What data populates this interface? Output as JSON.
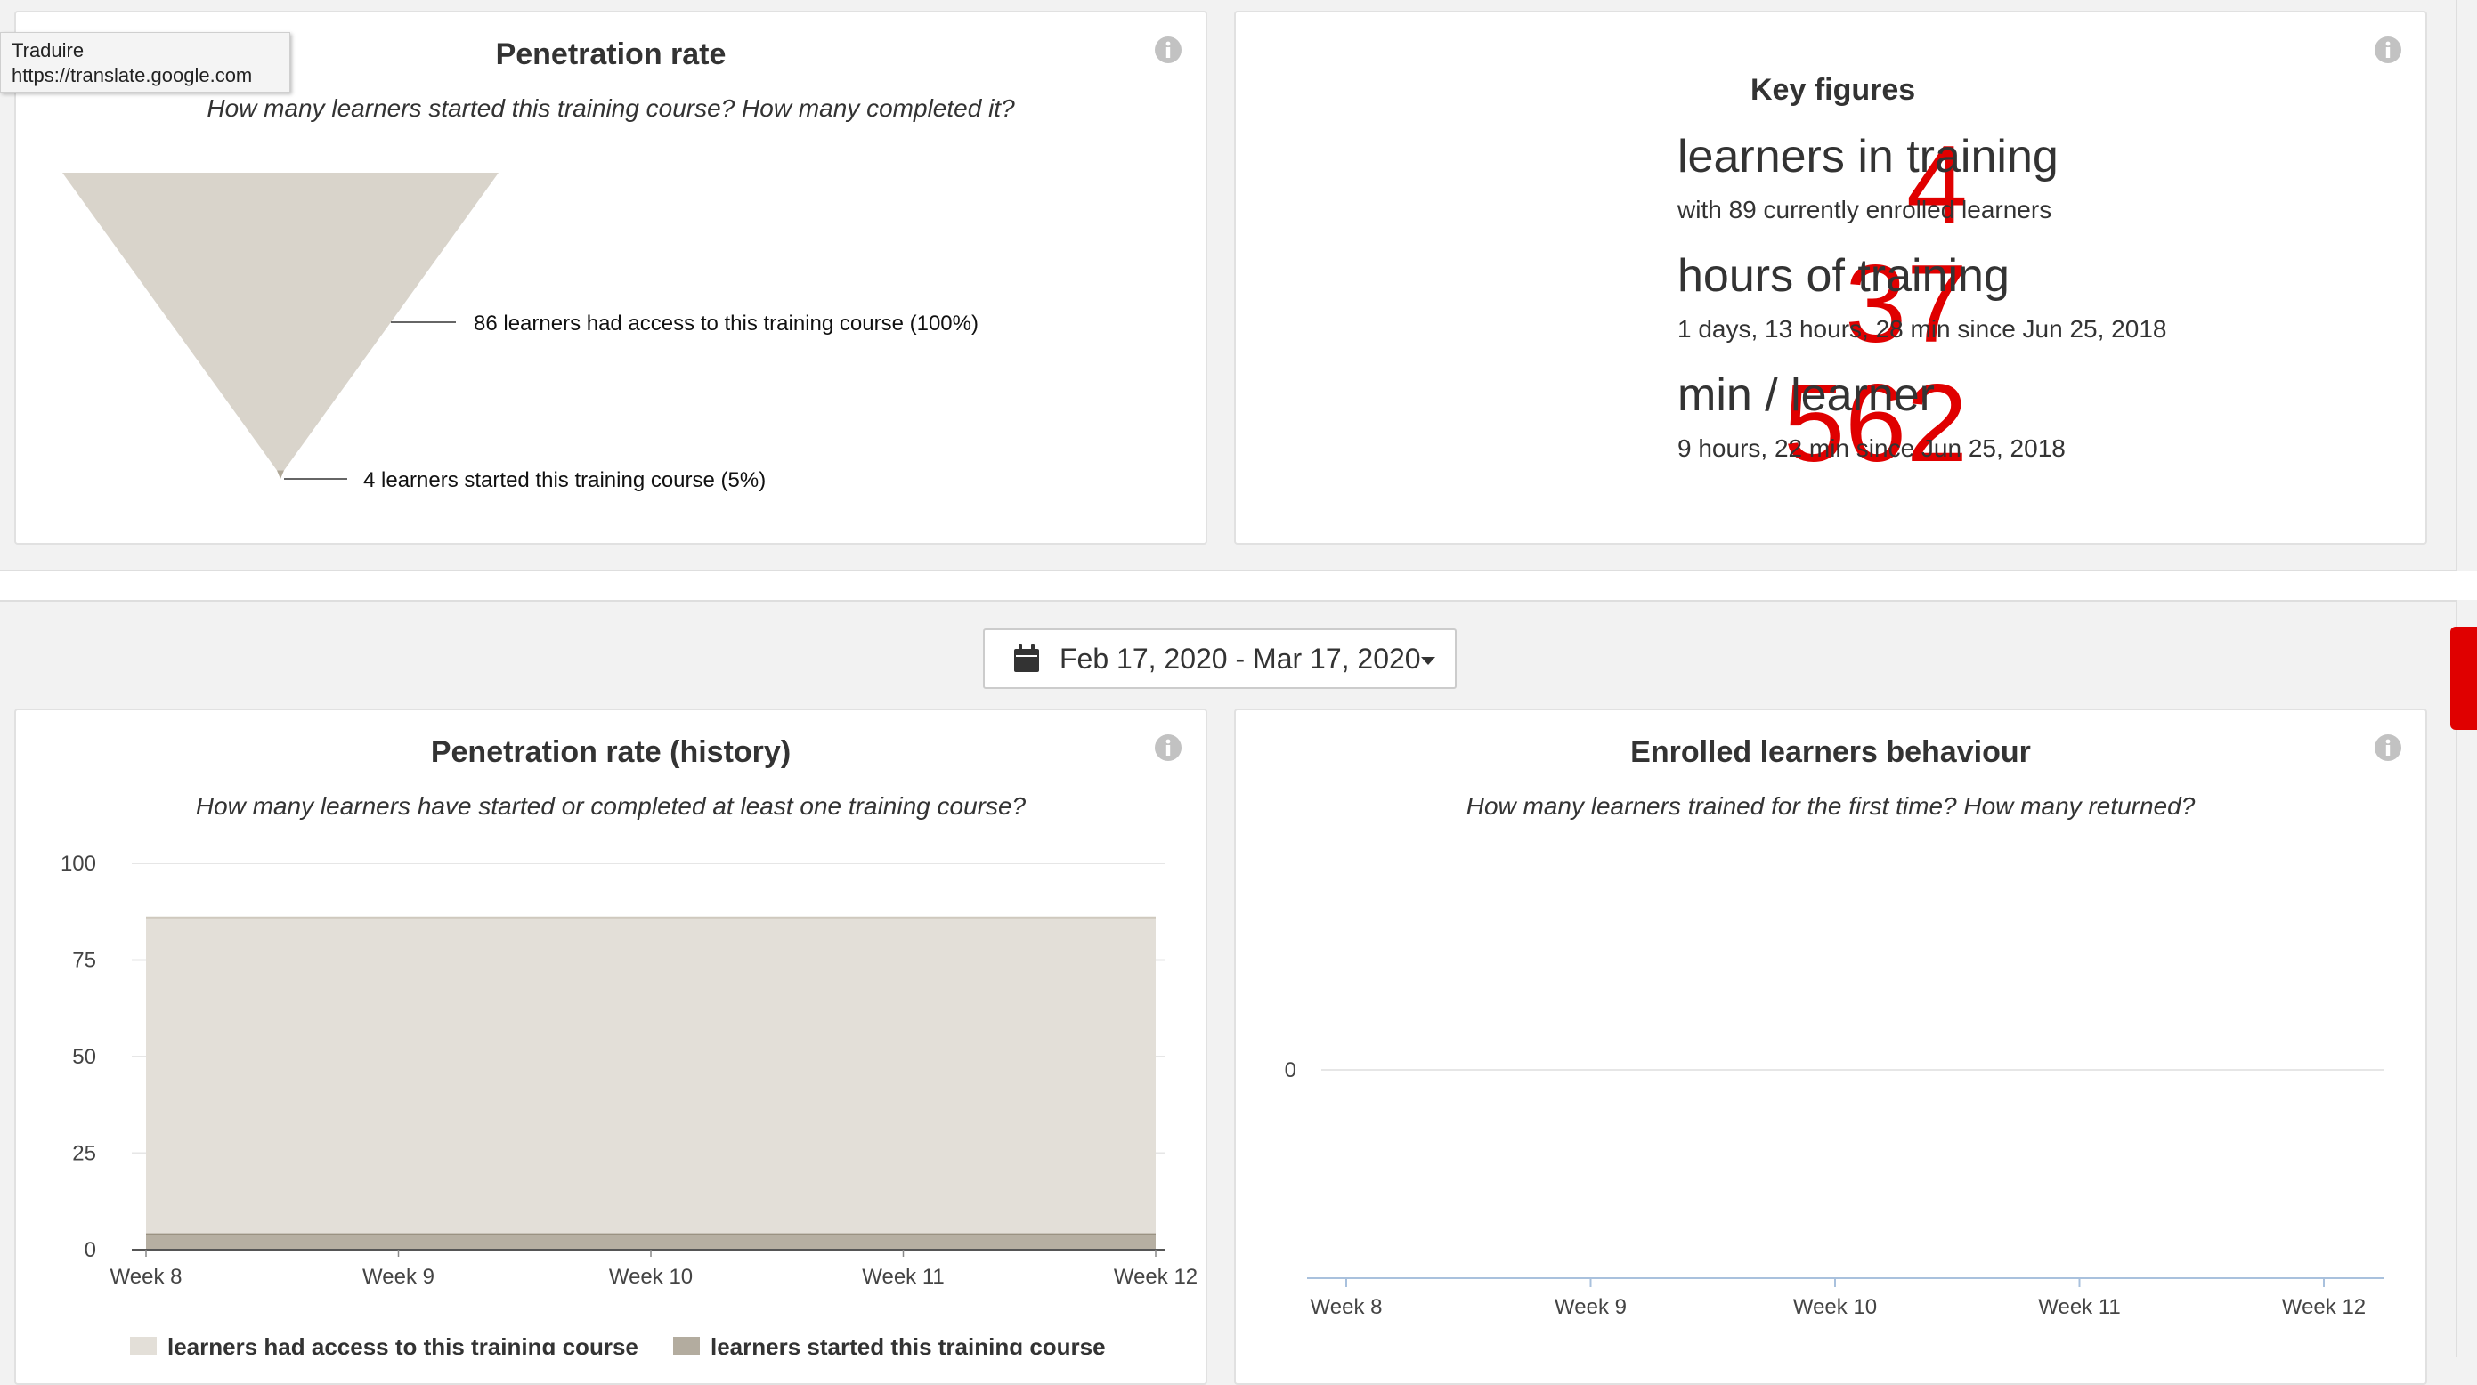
{
  "tooltip": {
    "title": "Traduire",
    "url": "https://translate.google.com"
  },
  "funnel_card": {
    "title": "Penetration rate",
    "subtitle": "How many learners started this training course? How many completed it?",
    "chart_data": {
      "type": "funnel",
      "stages": [
        {
          "label": "86 learners had access to this training course (100%)",
          "value": 86,
          "percent": 100
        },
        {
          "label": "4 learners started this training course (5%)",
          "value": 4,
          "percent": 5
        }
      ],
      "colors": [
        "#d9d4cb",
        "#b0a898"
      ]
    }
  },
  "key_figures": {
    "title": "Key figures",
    "rows": [
      {
        "number": "4",
        "label": "learners in training",
        "detail": "with 89 currently enrolled learners"
      },
      {
        "number": "37",
        "label": "hours of training",
        "detail": "1 days, 13 hours, 28 min since Jun 25, 2018"
      },
      {
        "number": "562",
        "label": "min / learner",
        "detail": "9 hours, 22 min since Jun 25, 2018"
      }
    ],
    "accent_color": "#e00000"
  },
  "date_range": {
    "label": "Feb 17, 2020 - Mar 17, 2020",
    "icon": "calendar-icon"
  },
  "history_card": {
    "title": "Penetration rate (history)",
    "subtitle": "How many learners have started or completed at least one training course?",
    "chart_data": {
      "type": "area",
      "categories": [
        "Week 8",
        "Week 9",
        "Week 10",
        "Week 11",
        "Week 12"
      ],
      "ylim": [
        0,
        100
      ],
      "yticks": [
        0,
        25,
        50,
        75,
        100
      ],
      "series": [
        {
          "name": "learners had access to this training course",
          "values": [
            86,
            86,
            86,
            86,
            86
          ],
          "color": "#e3dfd8"
        },
        {
          "name": "learners started this training course",
          "values": [
            4,
            4,
            4,
            4,
            4
          ],
          "color": "#b3ac9f"
        }
      ],
      "grid": true,
      "legend": "bottom"
    }
  },
  "behaviour_card": {
    "title": "Enrolled learners behaviour",
    "subtitle": "How many learners trained for the first time? How many returned?",
    "chart_data": {
      "type": "line",
      "categories": [
        "Week 8",
        "Week 9",
        "Week 10",
        "Week 11",
        "Week 12"
      ],
      "yticks": [
        0
      ],
      "series": []
    }
  }
}
